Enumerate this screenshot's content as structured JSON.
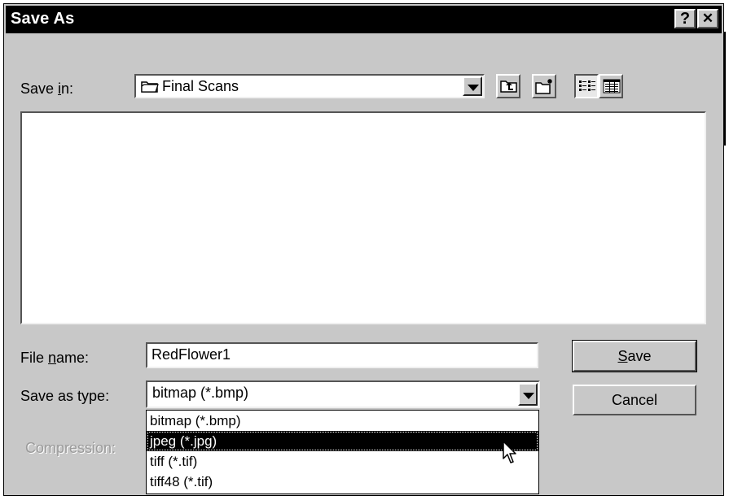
{
  "dialog": {
    "title": "Save As",
    "help_glyph": "?",
    "close_glyph": "✕"
  },
  "save_in": {
    "label_prefix": "Save ",
    "label_mnemonic": "i",
    "label_suffix": "n:",
    "value": "Final Scans",
    "folder_icon": "folder-icon"
  },
  "toolbar": {
    "up_folder": "up-one-level-icon",
    "new_folder": "new-folder-icon",
    "list_view": "list-view-icon",
    "details_view": "details-view-icon"
  },
  "file_name": {
    "label_prefix": "File ",
    "label_mnemonic": "n",
    "label_suffix": "ame:",
    "value": "RedFlower1"
  },
  "save_as_type": {
    "label": "Save as type:",
    "value": "bitmap (*.bmp)",
    "options": [
      "bitmap (*.bmp)",
      "jpeg (*.jpg)",
      "tiff (*.tif)",
      "tiff48 (*.tif)"
    ],
    "selected_index": 1
  },
  "compression": {
    "label": "Compression:"
  },
  "buttons": {
    "save_mnemonic": "S",
    "save_rest": "ave",
    "cancel": "Cancel"
  },
  "colors": {
    "title_bar": "#000000",
    "dialog_face": "#c8c8c8",
    "selection": "#000000"
  }
}
